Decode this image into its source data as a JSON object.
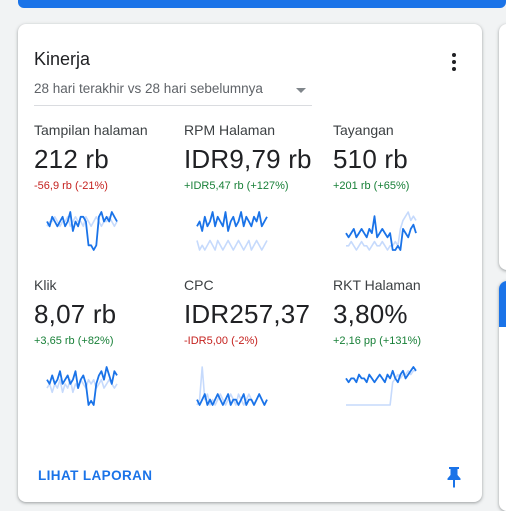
{
  "card": {
    "title": "Kinerja",
    "date_range": "28 hari terakhir vs 28 hari sebelumnya",
    "view_report": "LIHAT LAPORAN"
  },
  "colors": {
    "accent": "#1a73e8",
    "current_series": "#1a73e8",
    "previous_series": "#c6dafc",
    "negative": "#c5221f",
    "positive": "#188038"
  },
  "metrics": [
    {
      "name": "Tampilan halaman",
      "value": "212 rb",
      "change": "-56,9 rb (-21%)",
      "trend": "neg",
      "current": [
        6,
        5,
        7,
        6,
        5,
        6,
        7,
        5,
        6,
        8,
        4,
        6,
        5,
        7,
        7,
        6,
        1,
        1,
        0,
        1,
        7,
        8,
        6,
        7,
        6,
        8,
        7,
        6
      ],
      "previous": [
        5,
        6,
        6,
        7,
        6,
        5,
        6,
        6,
        7,
        5,
        6,
        7,
        6,
        6,
        5,
        7,
        6,
        5,
        6,
        7,
        6,
        5,
        6,
        6,
        7,
        6,
        5,
        6
      ]
    },
    {
      "name": "RPM Halaman",
      "value": "IDR9,79 rb",
      "change": "+IDR5,47 rb (+127%)",
      "trend": "pos",
      "current": [
        6,
        7,
        5,
        8,
        6,
        7,
        9,
        6,
        8,
        7,
        6,
        9,
        5,
        7,
        8,
        6,
        7,
        9,
        6,
        8,
        7,
        6,
        8,
        7,
        9,
        6,
        7,
        8
      ],
      "previous": [
        3,
        1,
        2,
        1,
        2,
        3,
        2,
        1,
        3,
        2,
        1,
        2,
        3,
        2,
        1,
        2,
        3,
        2,
        1,
        2,
        3,
        1,
        2,
        3,
        2,
        1,
        2,
        3
      ]
    },
    {
      "name": "Tayangan",
      "value": "510 rb",
      "change": "+201 rb (+65%)",
      "trend": "pos",
      "current": [
        5,
        4,
        5,
        6,
        4,
        5,
        6,
        5,
        4,
        6,
        5,
        9,
        4,
        5,
        6,
        5,
        4,
        5,
        1,
        1,
        2,
        1,
        6,
        5,
        4,
        6,
        7,
        5
      ],
      "previous": [
        2,
        2,
        3,
        2,
        1,
        2,
        3,
        2,
        2,
        1,
        2,
        3,
        2,
        2,
        3,
        2,
        1,
        2,
        2,
        3,
        2,
        6,
        8,
        9,
        10,
        8,
        9,
        8
      ]
    },
    {
      "name": "Klik",
      "value": "8,07 rb",
      "change": "+3,65 rb (+82%)",
      "trend": "pos",
      "current": [
        6,
        5,
        7,
        5,
        6,
        8,
        5,
        6,
        7,
        5,
        6,
        8,
        4,
        6,
        7,
        5,
        0,
        1,
        0,
        5,
        7,
        8,
        6,
        9,
        7,
        5,
        8,
        7
      ],
      "previous": [
        4,
        5,
        3,
        5,
        4,
        6,
        3,
        5,
        4,
        6,
        3,
        5,
        4,
        6,
        5,
        4,
        6,
        5,
        6,
        4,
        5,
        6,
        4,
        5,
        6,
        5,
        4,
        5
      ]
    },
    {
      "name": "CPC",
      "value": "IDR257,37",
      "change": "-IDR5,00 (-2%)",
      "trend": "neg",
      "current": [
        3,
        2,
        3,
        4,
        2,
        3,
        2,
        3,
        4,
        3,
        2,
        3,
        4,
        2,
        3,
        3,
        2,
        3,
        4,
        2,
        3,
        3,
        2,
        3,
        4,
        3,
        2,
        3
      ],
      "previous": [
        2,
        3,
        9,
        3,
        4,
        2,
        3,
        2,
        3,
        4,
        3,
        2,
        3,
        4,
        3,
        2,
        4,
        3,
        2,
        3,
        4,
        3,
        2,
        3,
        4,
        3,
        2,
        3
      ]
    },
    {
      "name": "RKT Halaman",
      "value": "3,80%",
      "change": "+2,16 pp (+131%)",
      "trend": "pos",
      "current": [
        8,
        7,
        8,
        8,
        7,
        9,
        8,
        8,
        7,
        9,
        8,
        7,
        8,
        9,
        8,
        7,
        9,
        8,
        10,
        8,
        7,
        9,
        10,
        8,
        9,
        10,
        11,
        10
      ],
      "previous": [
        1,
        1,
        1,
        1,
        1,
        1,
        1,
        1,
        1,
        1,
        1,
        1,
        1,
        1,
        1,
        1,
        1,
        1,
        7,
        8,
        9,
        8,
        9,
        9,
        10,
        9,
        10,
        10
      ]
    }
  ]
}
